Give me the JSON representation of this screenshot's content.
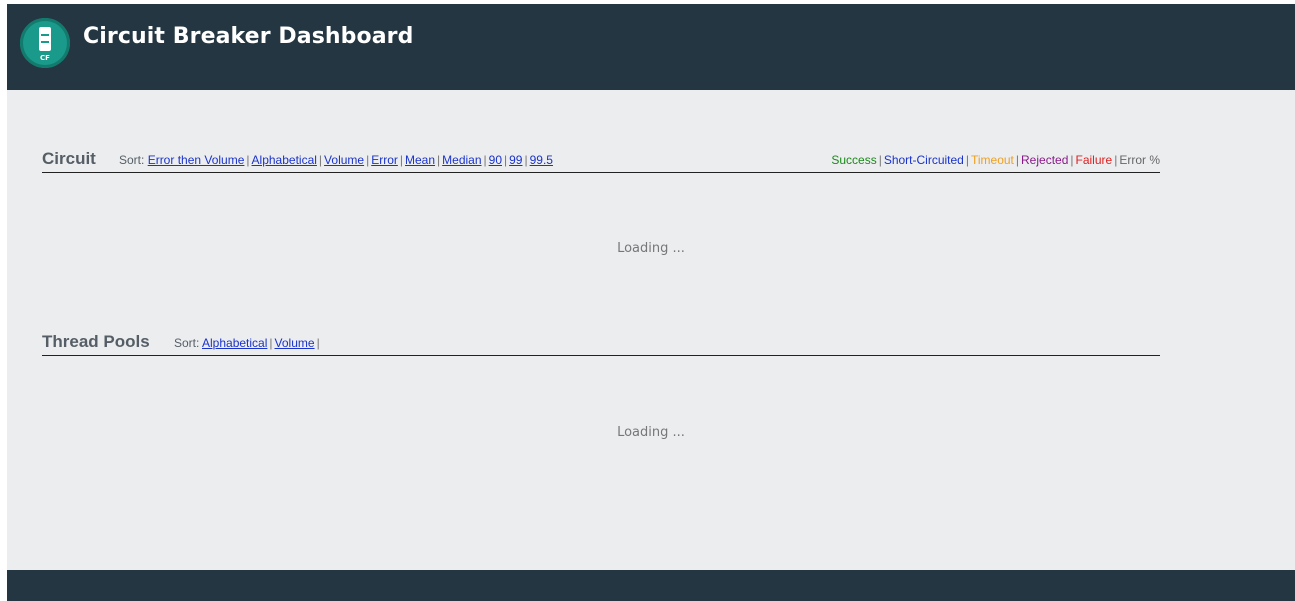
{
  "header": {
    "title": "Circuit Breaker Dashboard",
    "logo_text": "CF",
    "background": "#243641"
  },
  "circuit": {
    "title": "Circuit",
    "sort_label": "Sort:",
    "sort_options": [
      "Error then Volume",
      "Alphabetical",
      "Volume",
      "Error",
      "Mean",
      "Median",
      "90",
      "99",
      "99.5"
    ],
    "legend": [
      {
        "label": "Success",
        "color": "#1a8a1a"
      },
      {
        "label": "Short-Circuited",
        "color": "#1a33cc"
      },
      {
        "label": "Timeout",
        "color": "#f0a020"
      },
      {
        "label": "Rejected",
        "color": "#8a1a8a"
      },
      {
        "label": "Failure",
        "color": "#e02020"
      },
      {
        "label": "Error %",
        "color": "#666666"
      }
    ],
    "loading": "Loading ..."
  },
  "thread_pools": {
    "title": "Thread Pools",
    "sort_label": "Sort:",
    "sort_options": [
      "Alphabetical",
      "Volume"
    ],
    "loading": "Loading ..."
  },
  "separator": "|"
}
